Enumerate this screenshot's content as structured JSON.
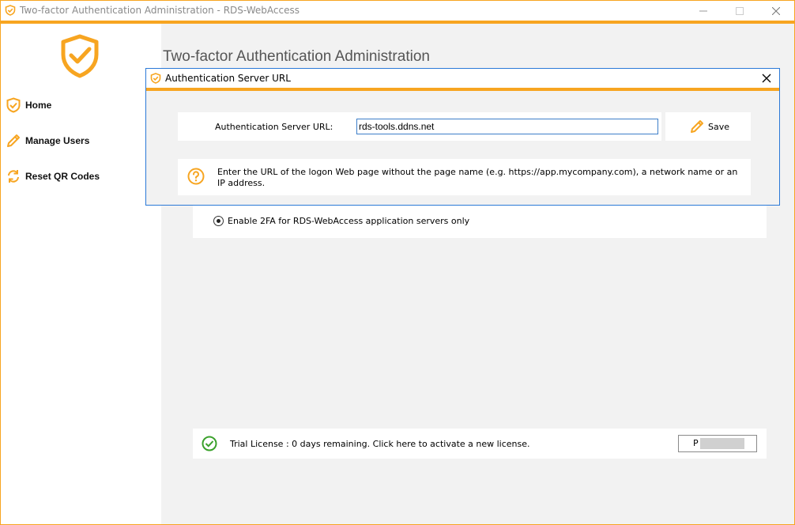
{
  "window": {
    "title": "Two-factor Authentication Administration - RDS-WebAccess",
    "accent_color": "#f7a521"
  },
  "sidebar": {
    "logo_icon": "shield-check-icon",
    "items": [
      {
        "label": "Home",
        "icon": "shield-check-icon"
      },
      {
        "label": "Manage Users",
        "icon": "pencil-icon"
      },
      {
        "label": "Reset QR Codes",
        "icon": "refresh-icon"
      }
    ]
  },
  "main": {
    "page_title": "Two-factor Authentication Administration",
    "radio_option": {
      "label": "Enable 2FA for RDS-WebAccess application servers only",
      "selected": true
    },
    "license": {
      "text": "Trial License : 0 days remaining. Click here to activate a new license.",
      "field_value": "P"
    }
  },
  "dialog": {
    "title": "Authentication Server URL",
    "url_label": "Authentication Server URL:",
    "url_value": "rds-tools.ddns.net",
    "save_label": "Save",
    "help_text": "Enter the URL of the logon Web page without the page name (e.g. https://app.mycompany.com), a network name or an IP address."
  }
}
